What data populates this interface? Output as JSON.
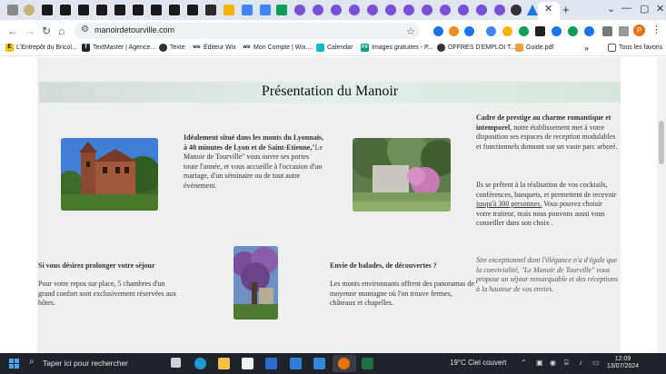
{
  "browser": {
    "url": "manoirdetourville.com",
    "bookmarks": [
      "L'Entrepôt du Bricol...",
      "TextMaster | Agence...",
      "Texte",
      "Éditeur Wix",
      "Mon Compte | Wix....",
      "Calendar",
      "Images gratuites - P...",
      "OFFRES D'EMPLOI T...",
      "Guide.pdf"
    ],
    "all_bookmarks": "Tous les favoris",
    "more": "»",
    "profile_initial": "P"
  },
  "page": {
    "title": "Présentation du Manoir",
    "block1": {
      "bold": "Idéalement situé dans les monts du Lyonnais, à 40 minutes de Lyon et de Saint-Etienne,",
      "rest": "\"Le Manoir de Tourville\" vous ouvre ses portes toute l'année, et vous accueille à l'occasion d'un mariage, d'un séminaire ou de tout autre événement."
    },
    "block2": {
      "bold": "Cadre de prestige au charme romantique et intemporel",
      "rest": ", notre établissement met à votre disposition ses espaces de reception modulables et fonctionnels donnant sur un vaste parc arboré."
    },
    "block3": {
      "before": "Ils se prêtent à la réalisation de vos cocktails, conférences, banquets, et permettent de recevoir ",
      "link": "jusqu'à 300 personnes.",
      "after": " Vous pouvez choisir votre traiteur, mais nous pouvons aussi vous conseiller dans son choix ."
    },
    "block4": {
      "heading": "Si vous désirez prolonger votre séjour",
      "text": "Pour votre repos sur place, 5 chambres d'un grand confort sont exclusivement réservées aux hôtes."
    },
    "block5": {
      "heading": "Envie de balades, de découvertes ?",
      "text": "Les monts environnants offrent des panoramas de moyenne montagne où l'on trouve fermes, châteaux et chapelles."
    },
    "block6": {
      "text": "Site exceptionnel dont l'élégance n'a d'égale que la convivialité, \"Le Manoir de Tourville\" vous propose un séjour remarquable et des réceptions à la hauteur de vos envies."
    }
  },
  "taskbar": {
    "search_placeholder": "Taper ici pour rechercher",
    "weather": "19°C  Ciel couvert",
    "time": "12:09",
    "date": "13/07/2024"
  }
}
